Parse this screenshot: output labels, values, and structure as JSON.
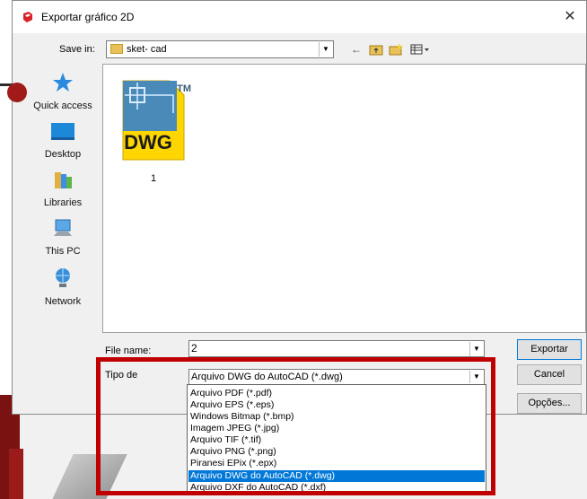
{
  "window": {
    "title": "Exportar gráfico 2D"
  },
  "save_in": {
    "label": "Save in:",
    "value": "sket- cad"
  },
  "places": [
    {
      "label": "Quick access",
      "icon": "star-icon"
    },
    {
      "label": "Desktop",
      "icon": "desktop-icon"
    },
    {
      "label": "Libraries",
      "icon": "libraries-icon"
    },
    {
      "label": "This PC",
      "icon": "computer-icon"
    },
    {
      "label": "Network",
      "icon": "network-icon"
    }
  ],
  "files": [
    {
      "name": "1",
      "tm": "TM",
      "badge": "DWG"
    }
  ],
  "file_name": {
    "label": "File name:",
    "value": "2"
  },
  "file_type": {
    "label": "Tipo de",
    "value": "Arquivo DWG do AutoCAD (*.dwg)",
    "options": [
      "Arquivo PDF (*.pdf)",
      "Arquivo EPS (*.eps)",
      "Windows Bitmap (*.bmp)",
      "Imagem JPEG (*.jpg)",
      "Arquivo TIF (*.tif)",
      "Arquivo PNG (*.png)",
      "Piranesi EPix (*.epx)",
      "Arquivo DWG do AutoCAD (*.dwg)",
      "Arquivo DXF do AutoCAD (*.dxf)"
    ],
    "selected_index": 7
  },
  "buttons": {
    "export": "Exportar",
    "cancel": "Cancel",
    "options": "Opções..."
  },
  "colors": {
    "highlight": "#c00000",
    "selection": "#0078d7",
    "dwg_badge": "#e8b400"
  }
}
